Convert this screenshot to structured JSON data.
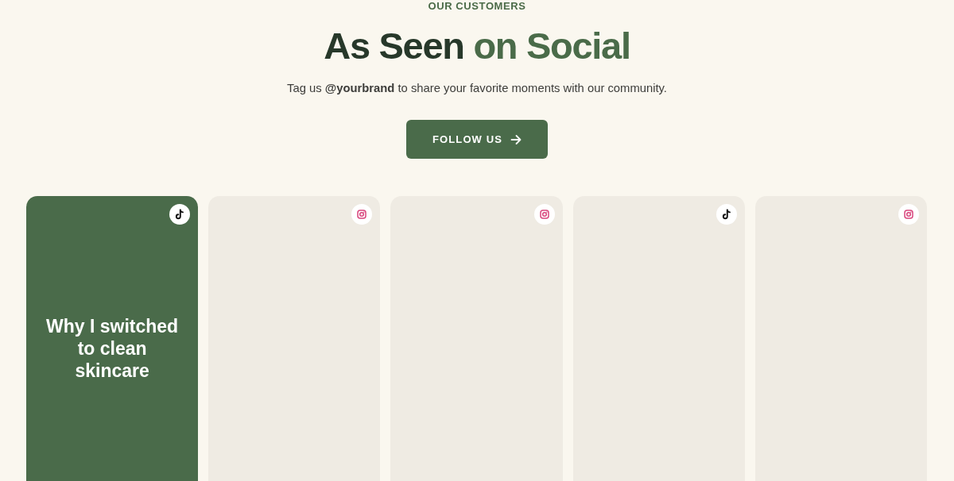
{
  "eyebrow": "OUR CUSTOMERS",
  "title": {
    "lead": "As Seen",
    "accent": "on Social"
  },
  "subtitle": "Tag us **@yourbrand** to share your favorite moments with our community.",
  "follow_button": {
    "label": "FOLLOW US"
  },
  "posts": [
    {
      "kind": "text",
      "badge": {
        "kind": "tiktok"
      },
      "caption": "Why I switched to clean skincare"
    },
    {
      "kind": "image",
      "badge": {
        "kind": "instagram"
      }
    },
    {
      "kind": "image",
      "badge": {
        "kind": "instagram"
      }
    },
    {
      "kind": "image",
      "badge": {
        "kind": "tiktok"
      }
    },
    {
      "kind": "image",
      "badge": {
        "kind": "instagram"
      }
    }
  ]
}
